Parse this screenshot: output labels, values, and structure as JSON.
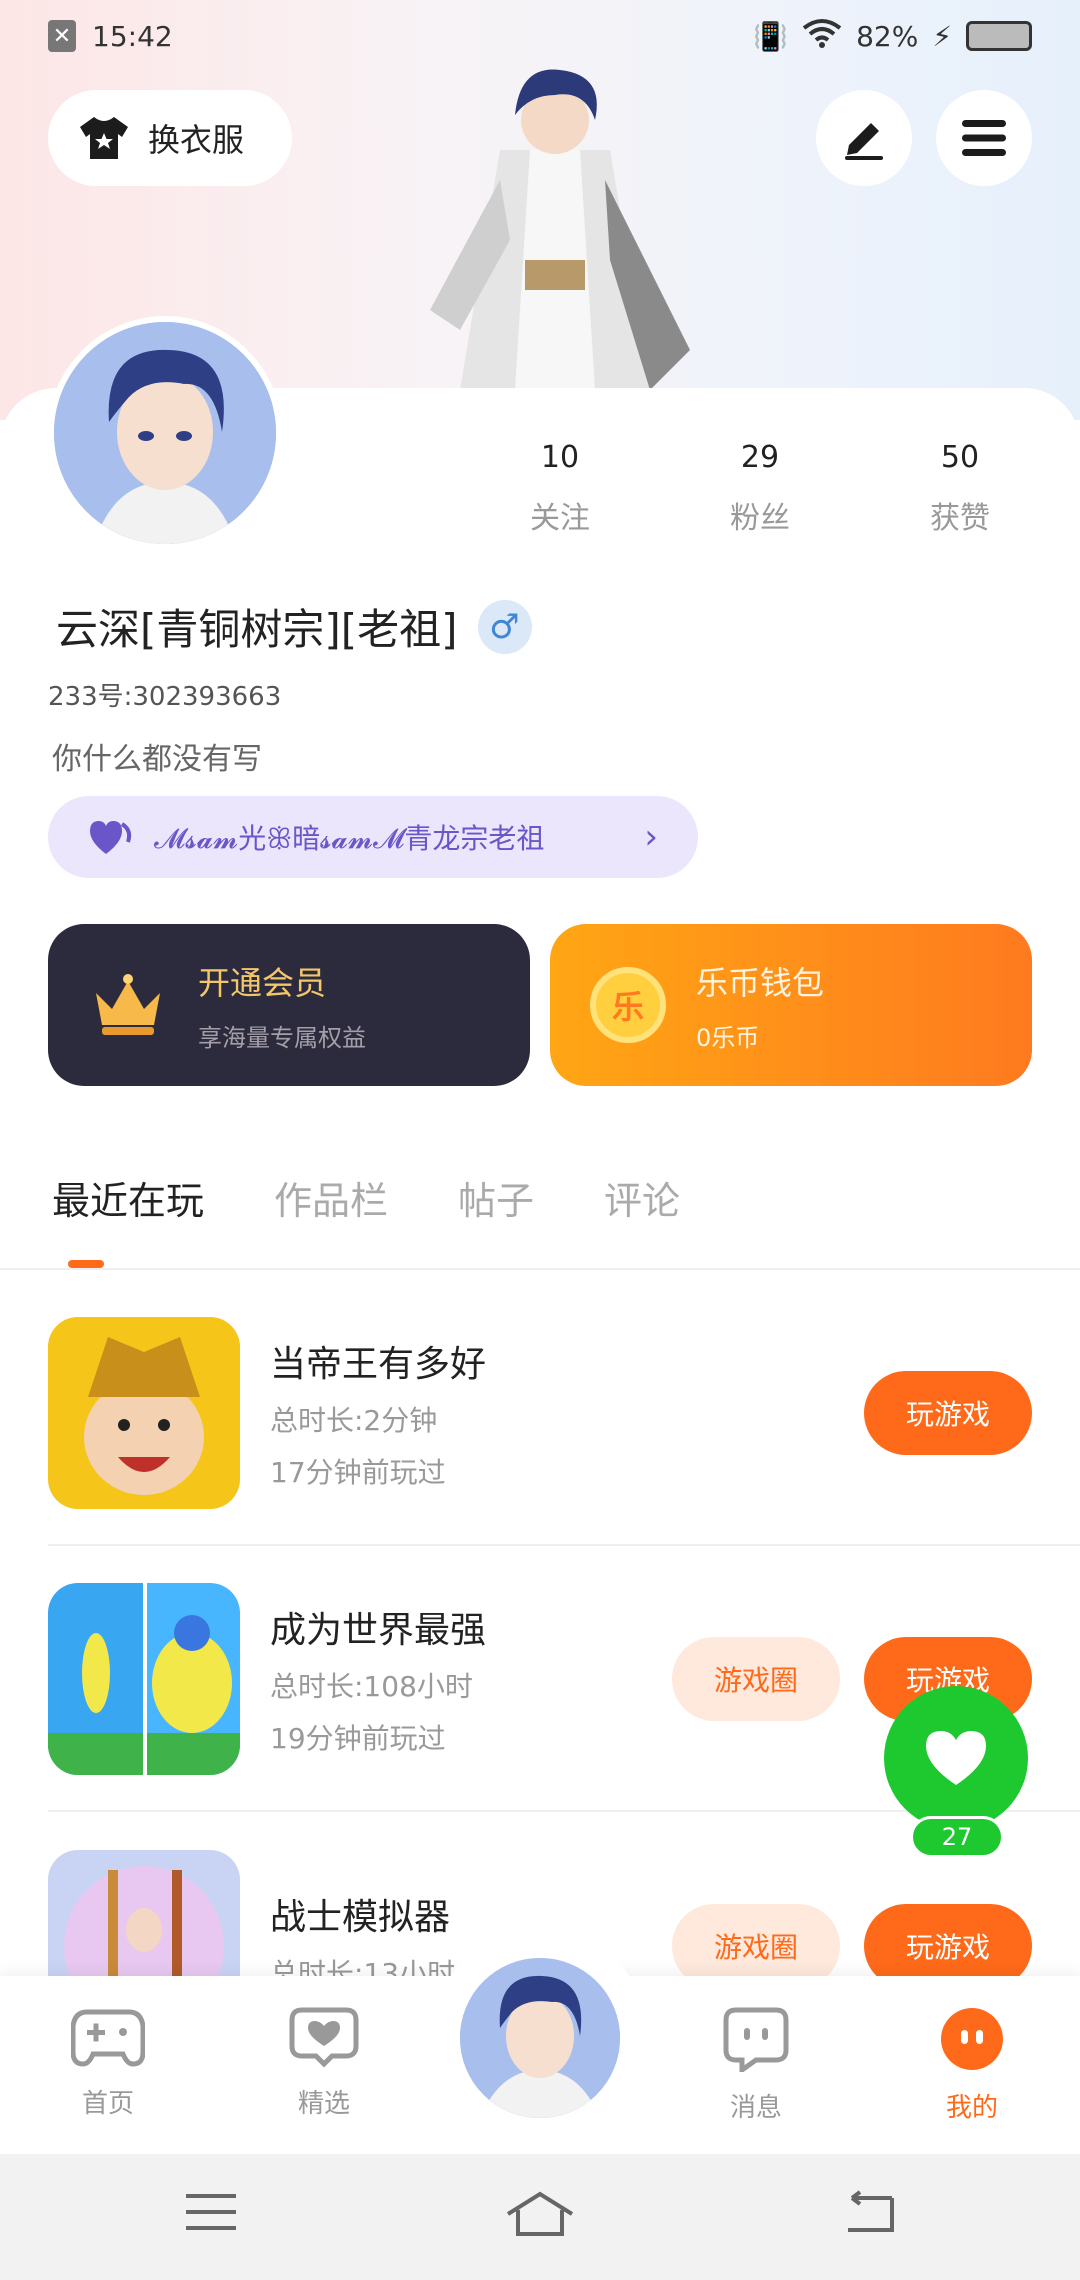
{
  "status_bar": {
    "time": "15:42",
    "battery_percent": "82%"
  },
  "header": {
    "wardrobe_label": "换衣服",
    "edit_icon": "pen-icon",
    "menu_icon": "hamburger-icon"
  },
  "profile": {
    "stats": [
      {
        "value": "10",
        "label": "关注"
      },
      {
        "value": "29",
        "label": "粉丝"
      },
      {
        "value": "50",
        "label": "获赞"
      }
    ],
    "name": "云深[青铜树宗][老祖]",
    "gender_symbol": "♂",
    "uid": "233号:302393663",
    "bio": "你什么都没有写",
    "guild": "𝓜𝓼𝓪𝓶光ꕥ暗𝓼𝓪𝓶𝓜青龙宗老祖",
    "guild_chevron": "›"
  },
  "promos": {
    "vip": {
      "title": "开通会员",
      "subtitle": "享海量专属权益"
    },
    "coin": {
      "title": "乐币钱包",
      "subtitle": "0乐币",
      "icon_glyph": "乐"
    }
  },
  "tabs": [
    "最近在玩",
    "作品栏",
    "帖子",
    "评论"
  ],
  "games": [
    {
      "title": "当帝王有多好",
      "duration": "总时长:2分钟",
      "last_played": "17分钟前玩过",
      "circle_label": "",
      "play_label": "玩游戏"
    },
    {
      "title": "成为世界最强",
      "duration": "总时长:108小时",
      "last_played": "19分钟前玩过",
      "circle_label": "游戏圈",
      "play_label": "玩游戏"
    },
    {
      "title": "战士模拟器",
      "duration": "总时长:13小时",
      "last_played": "",
      "circle_label": "游戏圈",
      "play_label": "玩游戏"
    }
  ],
  "float_like": {
    "count": "27"
  },
  "bottom_nav": [
    {
      "label": "首页",
      "icon": "gamepad-icon"
    },
    {
      "label": "精选",
      "icon": "heart-chat-icon"
    },
    {
      "label": "消息",
      "icon": "chat-icon"
    },
    {
      "label": "我的",
      "icon": "face-icon"
    }
  ],
  "colors": {
    "accent": "#ff6a1a",
    "like_green": "#1dc92f",
    "vip_bg": "#2c2a3d",
    "guild_bg": "#ebe6fb"
  }
}
